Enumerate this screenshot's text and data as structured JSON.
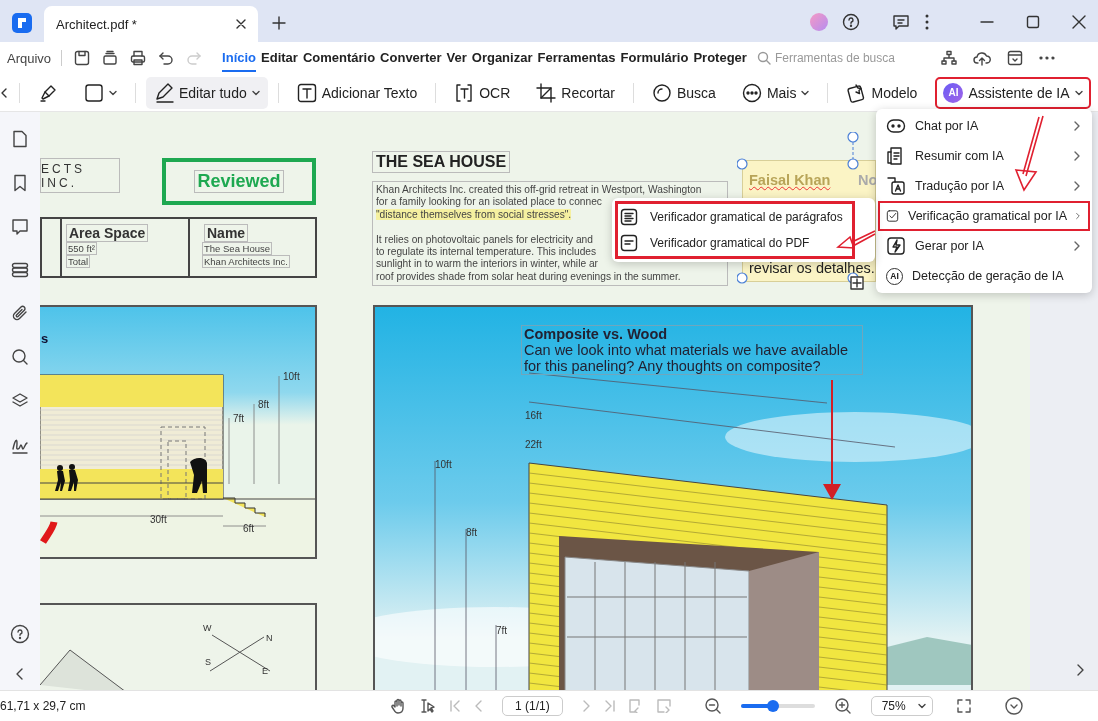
{
  "window": {
    "tab_title": "Architect.pdf *"
  },
  "menu_bar": {
    "file": "Arquivo",
    "tabs": [
      {
        "label": "Início",
        "selected": true
      },
      {
        "label": "Editar",
        "selected": false
      },
      {
        "label": "Comentário",
        "selected": false
      },
      {
        "label": "Converter",
        "selected": false
      },
      {
        "label": "Ver",
        "selected": false
      },
      {
        "label": "Organizar",
        "selected": false
      },
      {
        "label": "Ferramentas",
        "selected": false
      },
      {
        "label": "Formulário",
        "selected": false
      },
      {
        "label": "Proteger",
        "selected": false
      }
    ],
    "search": {
      "placeholder": "Ferramentas de busca"
    }
  },
  "toolbar": {
    "groups": [
      [
        {
          "kind": "highlighter",
          "active": false,
          "highlighted": false,
          "dropdown": false
        },
        {
          "kind": "shape",
          "active": false,
          "highlighted": false,
          "dropdown": true
        }
      ],
      [
        {
          "kind": "edit",
          "label": "Editar tudo",
          "active": true,
          "highlighted": false,
          "dropdown": true
        }
      ],
      [
        {
          "kind": "text",
          "label": "Adicionar Texto",
          "active": false,
          "highlighted": false,
          "dropdown": false
        }
      ],
      [
        {
          "kind": "ocr",
          "label": "OCR",
          "active": false,
          "highlighted": false,
          "dropdown": false
        },
        {
          "kind": "crop",
          "label": "Recortar",
          "active": false,
          "highlighted": false,
          "dropdown": false
        }
      ],
      [
        {
          "kind": "search",
          "label": "Busca",
          "active": false,
          "highlighted": false,
          "dropdown": false
        },
        {
          "kind": "more",
          "label": "Mais",
          "active": false,
          "highlighted": false,
          "dropdown": true
        }
      ],
      [
        {
          "kind": "template",
          "label": "Modelo",
          "active": false,
          "highlighted": false,
          "dropdown": false
        },
        {
          "kind": "ai",
          "badge": "AI",
          "label": "Assistente de IA",
          "active": false,
          "highlighted": true,
          "dropdown": true
        }
      ]
    ]
  },
  "document": {
    "company_label": "ECTS INC.",
    "stamp": "Reviewed",
    "table": {
      "columns": [
        "Area Space",
        "Name"
      ],
      "rows": [
        [
          "550 ft²",
          "The Sea House"
        ],
        [
          "Total",
          "Khan Architects Inc."
        ]
      ]
    },
    "elevation_labels": [
      "s",
      "10ft",
      "8ft",
      "7ft",
      "30ft",
      "6ft"
    ],
    "compass_labels": [
      "W",
      "N",
      "S",
      "E"
    ],
    "heading": "THE SEA HOUSE",
    "paragraphs": [
      [
        {
          "text": "Khan Architects Inc. created this off-grid retreat in Westport, Washington",
          "highlighted": false
        },
        {
          "text": "for a family looking for an isolated place to connec",
          "highlighted": false
        },
        {
          "text": "\"distance themselves from social stresses\".",
          "highlighted": true
        }
      ],
      [
        {
          "text": "It relies on photovoltaic panels for electricity and",
          "highlighted": false
        },
        {
          "text": "to regulate its internal temperature. This includes",
          "highlighted": false
        },
        {
          "text": "sunlight in to warm the interiors in winter, while ar",
          "highlighted": false
        },
        {
          "text": "roof provides shade from solar heat during evenings in the summer.",
          "highlighted": false
        }
      ]
    ],
    "note": {
      "author": "Faisal Khan",
      "cut_text": "No",
      "text": "revisar os detalhes."
    },
    "comment": {
      "title": "Composite vs. Wood",
      "text": "Can we look into what materials we have available for this paneling? Any thoughts on composite?"
    },
    "building_labels": [
      "16ft",
      "22ft",
      "10ft",
      "8ft",
      "7ft"
    ]
  },
  "ai_menu": {
    "items": [
      {
        "kind": "chat",
        "label": "Chat por IA",
        "submenu": true,
        "highlighted": false
      },
      {
        "kind": "summary",
        "label": "Resumir com IA",
        "submenu": true,
        "highlighted": false
      },
      {
        "kind": "translate",
        "label": "Tradução por IA",
        "submenu": true,
        "highlighted": false
      },
      {
        "kind": "grammar",
        "label": "Verificação gramatical por IA",
        "submenu": true,
        "highlighted": true
      },
      {
        "kind": "generate",
        "label": "Gerar por IA",
        "submenu": true,
        "highlighted": false
      },
      {
        "kind": "detect",
        "icon_text": "AI",
        "label": "Detecção de geração de IA",
        "submenu": false,
        "highlighted": false
      }
    ]
  },
  "submenu": {
    "highlighted": true,
    "items": [
      {
        "kind": "paragraph",
        "label": "Verificador gramatical de parágrafos"
      },
      {
        "kind": "pdf",
        "label": "Verificador gramatical do PDF"
      }
    ]
  },
  "status_bar": {
    "dimensions": "61,71 x 29,7 cm",
    "page": "1 (1/1)",
    "zoom": {
      "level": 0.43,
      "value": "75%"
    }
  }
}
